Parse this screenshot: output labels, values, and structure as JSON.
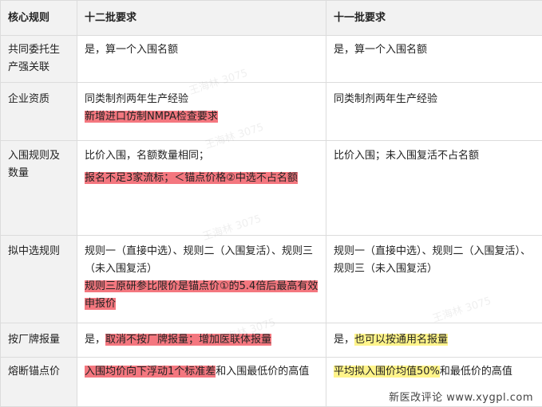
{
  "header": {
    "col1": "核心规则",
    "col2": "十二批要求",
    "col3": "十一批要求"
  },
  "rows": [
    {
      "rule": "共同委托生产强关联",
      "twelve": [
        "是，算一个入围名额"
      ],
      "eleven": [
        "是，算一个入围名额"
      ]
    },
    {
      "rule": "企业资质",
      "twelve": [
        "同类制剂两年生产经验",
        "新增进口仿制NMPA检查要求"
      ],
      "eleven": [
        "同类制剂两年生产经验"
      ]
    },
    {
      "rule": "入围规则及数量",
      "twelve": [
        "比价入围，名额数量相同；",
        "报名不足3家流标；＜锚点价格②中选不占名额"
      ],
      "eleven": [
        "比价入围；未入围复活不占名额"
      ]
    },
    {
      "rule": "拟中选规则",
      "twelve": [
        "规则一（直接中选）、规则二（入围复活）、规则三（未入围复活）",
        "规则三原研参比限价是锚点价①的5.4倍后最高有效申报价"
      ],
      "eleven": [
        "规则一（直接中选）、规则二（入围复活）、规则三（未入围复活）"
      ]
    },
    {
      "rule": "按厂牌报量",
      "twelve": [
        "是，",
        "取消不按厂牌报量；增加医联体报量"
      ],
      "eleven": [
        "是，",
        "也可以按通用名报量"
      ]
    },
    {
      "rule": "熔断锚点价",
      "twelve": [
        "入围均价向下浮动1个标准差",
        "和入围最低价的高值"
      ],
      "eleven": [
        "平均拟入围价均值50%",
        "和最低价的高值"
      ]
    }
  ],
  "watermark": "王海林 3075",
  "footer": "新医改评论 www.xygpl.com",
  "colors": {
    "highlight_red": "#f4777f",
    "highlight_yellow": "#fff48a",
    "header_bg": "#f2f2f2"
  }
}
